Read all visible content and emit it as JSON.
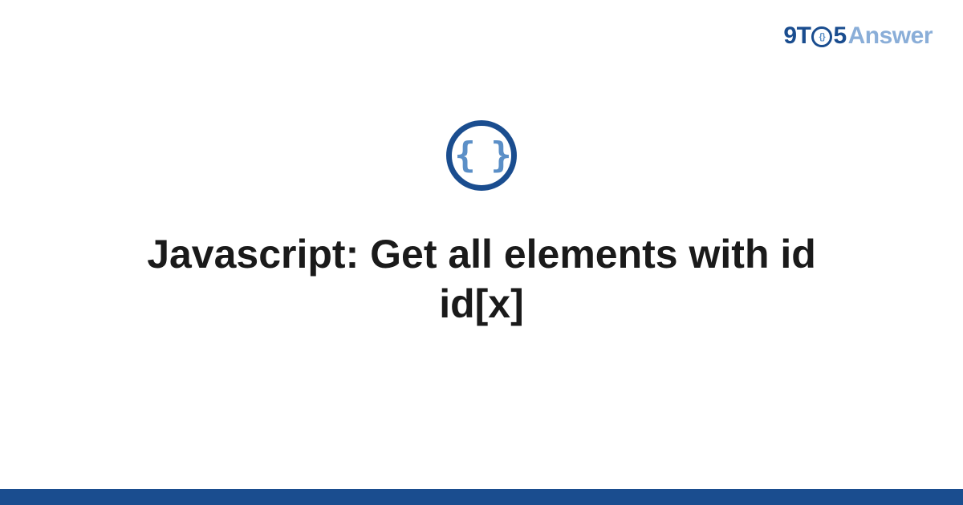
{
  "logo": {
    "part1": "9T",
    "part_o_inner": "{}",
    "part2": "5",
    "part3": "Answer"
  },
  "icon": {
    "symbol": "{ }",
    "name": "code-braces"
  },
  "title": "Javascript: Get all elements with id id[x]",
  "colors": {
    "primary": "#1a4d8f",
    "secondary": "#5b8fc7",
    "logo_light": "#8aaed8"
  }
}
